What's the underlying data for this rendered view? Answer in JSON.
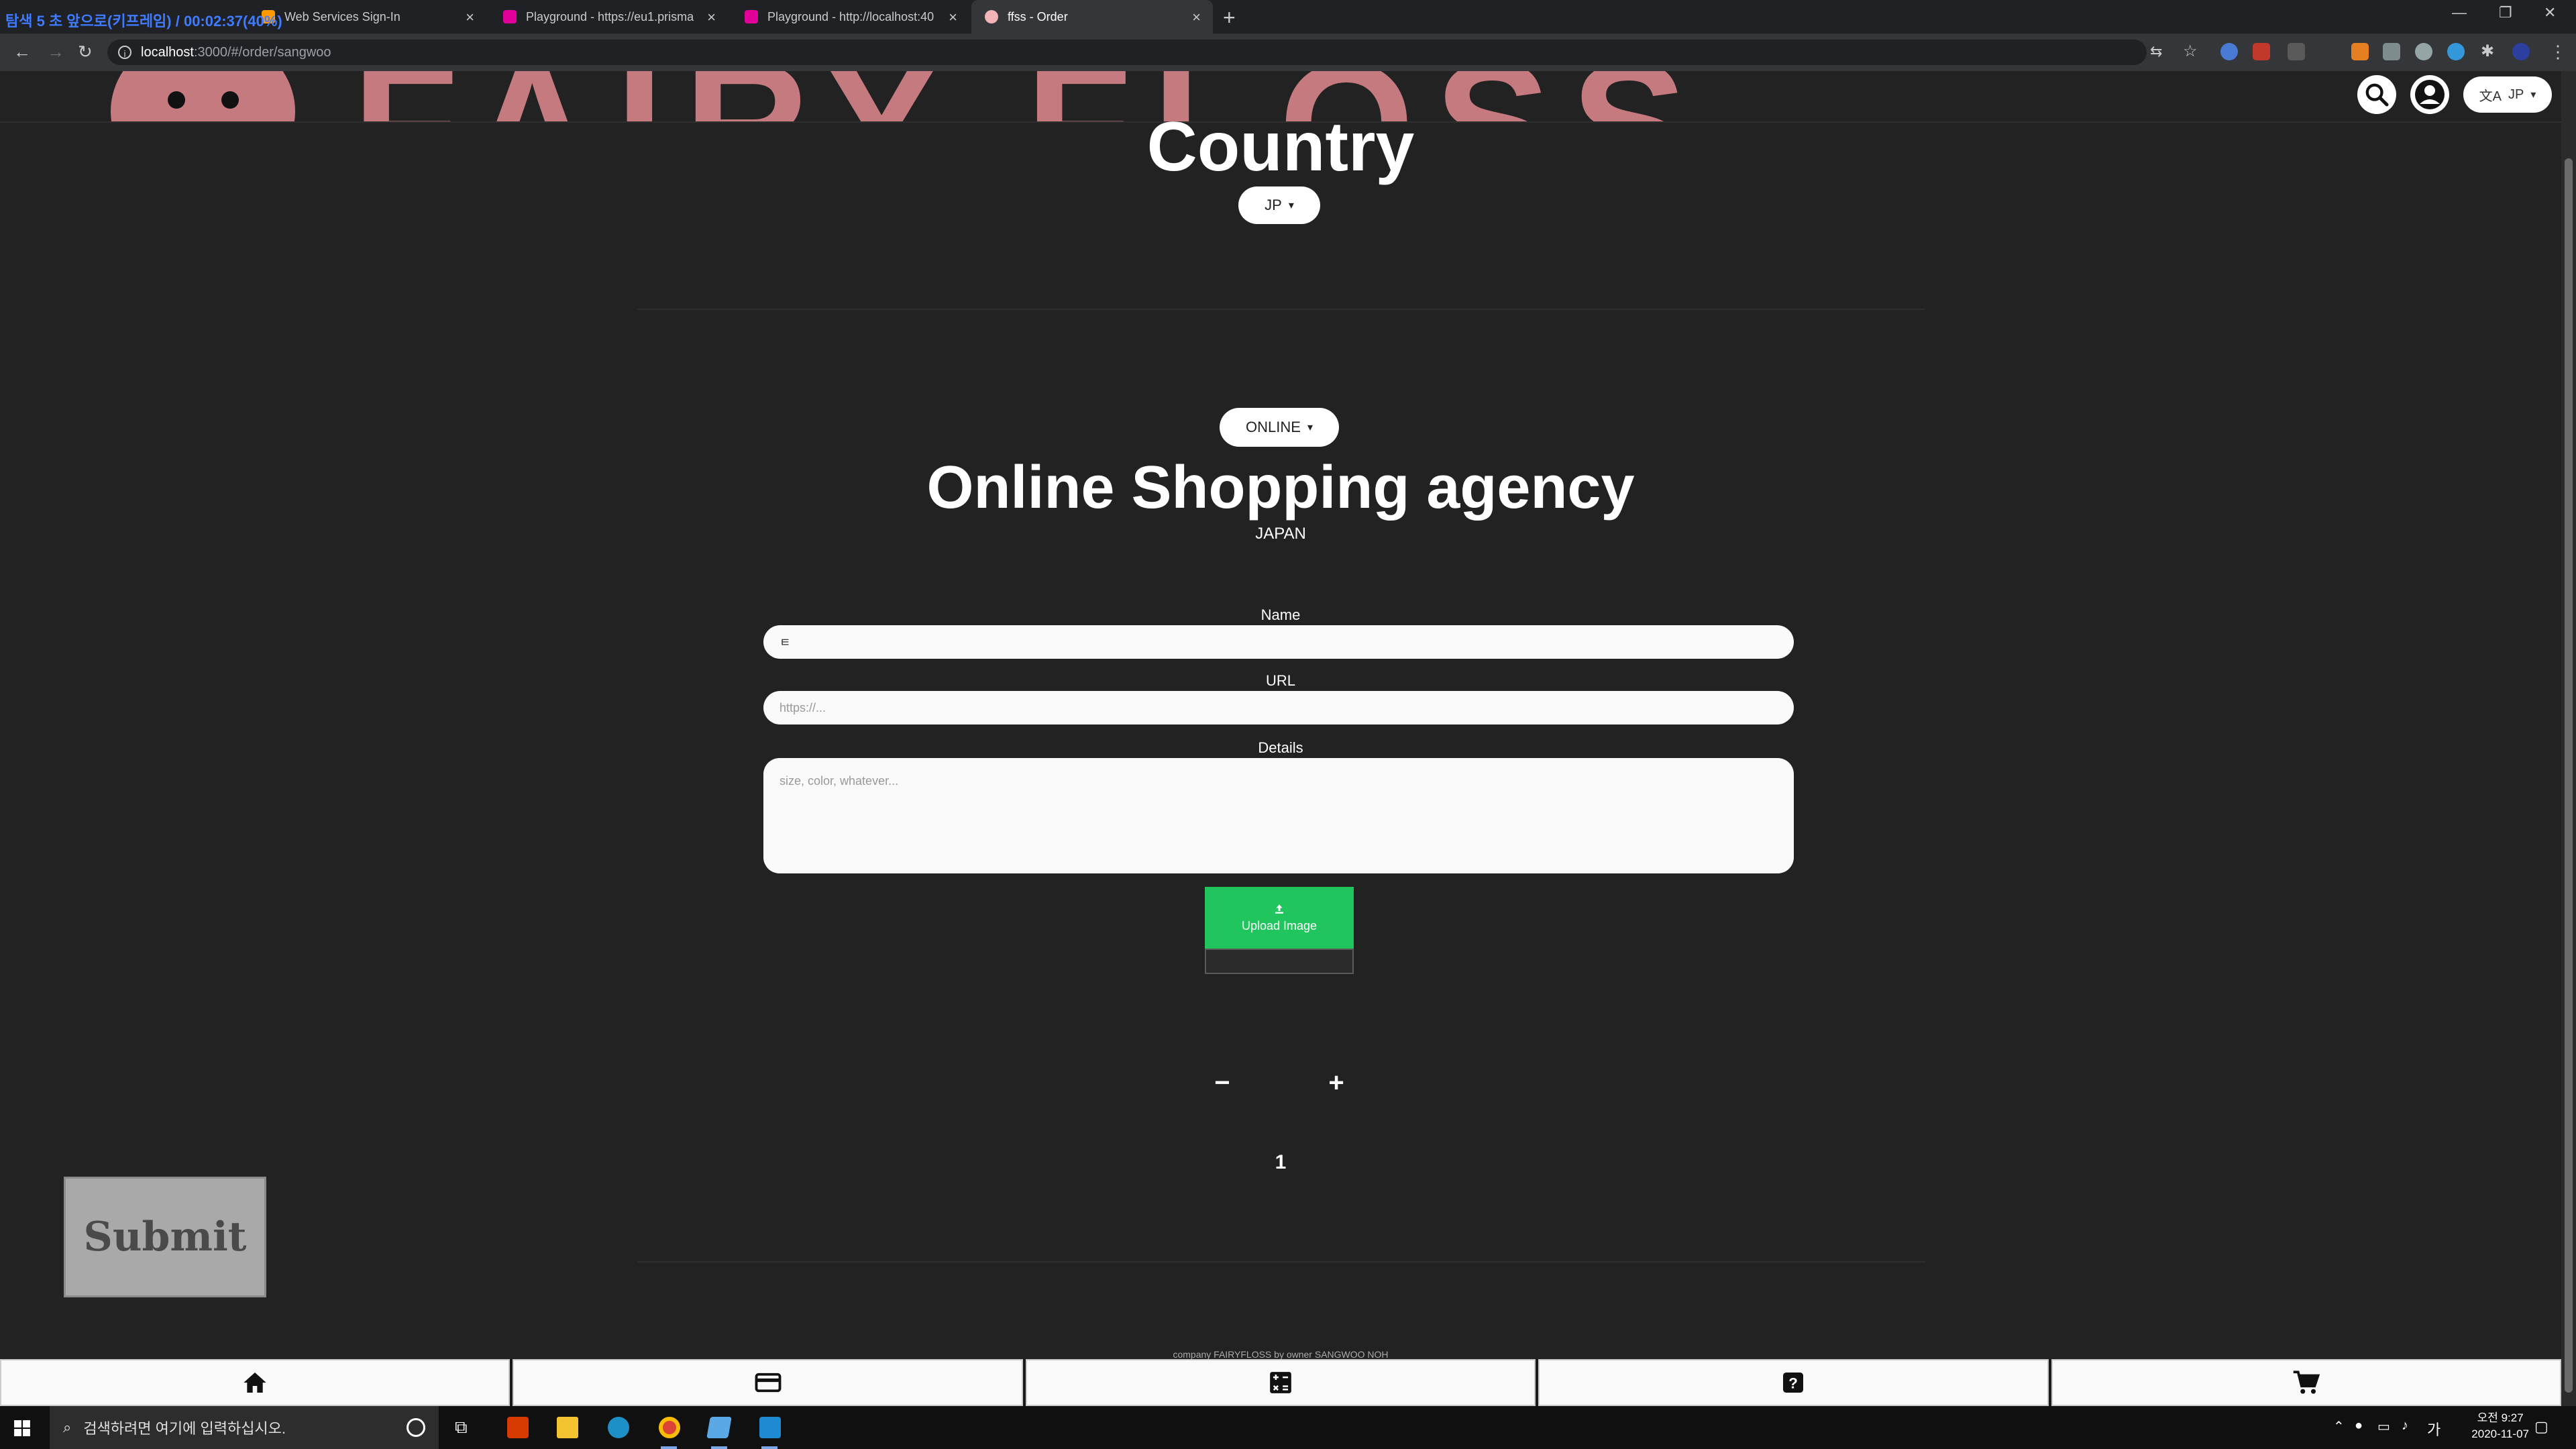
{
  "browser": {
    "recording_overlay": "탐색 5 초 앞으로(키프레임) / 00:02:37(40%)",
    "tabs": [
      {
        "title": "Web Services Sign-In"
      },
      {
        "title": "Playground - https://eu1.prisma"
      },
      {
        "title": "Playground - http://localhost:40"
      },
      {
        "title": "ffss - Order"
      }
    ],
    "new_tab": "+",
    "url_host": "localhost",
    "url_path": ":3000/#/order/sangwoo"
  },
  "header": {
    "logo_text": "FAIRY FLOSS",
    "language_label": "JP"
  },
  "country": {
    "title": "Country",
    "selected": "JP"
  },
  "service": {
    "selected": "ONLINE",
    "title": "Online Shopping agency",
    "subtitle": "JAPAN"
  },
  "form": {
    "name_label": "Name",
    "name_value": "ㅌ",
    "url_label": "URL",
    "url_placeholder": "https://...",
    "details_label": "Details",
    "details_placeholder": "size, color, whatever...",
    "upload_label": "Upload Image"
  },
  "quantity": {
    "minus": "−",
    "plus": "+",
    "value": "1"
  },
  "submit_label": "Submit",
  "footer_note": "company FAIRYFLOSS by owner SANGWOO NOH",
  "bottom_nav": [
    {
      "icon": "home-icon"
    },
    {
      "icon": "credit-card-icon"
    },
    {
      "icon": "calculator-icon"
    },
    {
      "icon": "question-icon"
    },
    {
      "icon": "cart-icon"
    }
  ],
  "taskbar": {
    "search_placeholder": "검색하려면 여기에 입력하십시오.",
    "ime": "가",
    "time": "오전 9:27",
    "date": "2020-11-07"
  },
  "colors": {
    "page_bg": "#222222",
    "upload_green": "#21c55d",
    "logo_pink": "#c47a7e",
    "submit_gray": "#a9a9a9"
  }
}
